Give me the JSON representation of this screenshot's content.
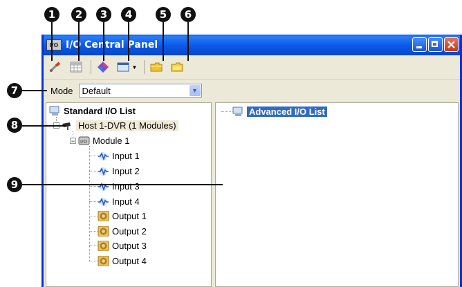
{
  "window": {
    "title": "I/O Central Panel",
    "icon_text": "I/O"
  },
  "callouts": [
    "1",
    "2",
    "3",
    "4",
    "5",
    "6",
    "7",
    "8",
    "9"
  ],
  "mode": {
    "label": "Mode",
    "value": "Default"
  },
  "tree": {
    "root": "Standard I/O List",
    "host": "Host 1-DVR (1 Modules)",
    "module": "Module 1",
    "inputs": [
      "Input 1",
      "Input 2",
      "Input 3",
      "Input 4"
    ],
    "outputs": [
      "Output 1",
      "Output 2",
      "Output 3",
      "Output 4"
    ]
  },
  "advanced": {
    "label": "Advanced I/O List"
  },
  "icons": [
    "wrench-icon",
    "grid-icon",
    "diamond-icon",
    "module-icon",
    "folder-icon",
    "folder-icon"
  ]
}
